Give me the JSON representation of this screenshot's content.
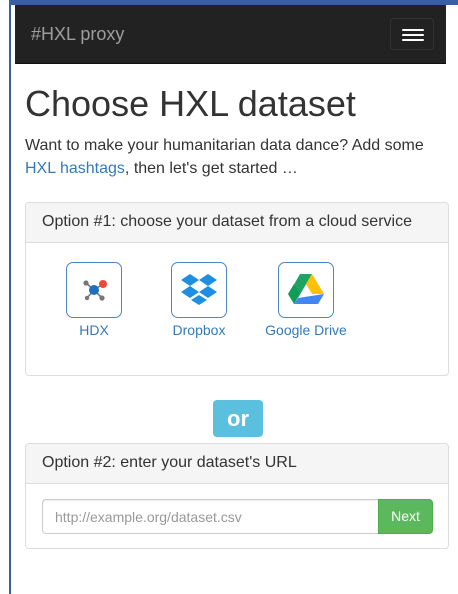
{
  "navbar": {
    "brand": "#HXL proxy",
    "menu_icon": "hamburger-icon"
  },
  "page": {
    "title": "Choose HXL dataset",
    "intro_before": "Want to make your humanitarian data dance? Add some ",
    "intro_link": "HXL hashtags",
    "intro_after": ", then let's get started …"
  },
  "option1": {
    "heading": "Option #1: choose your dataset from a cloud service",
    "services": [
      {
        "label": "HDX",
        "icon": "hdx-icon"
      },
      {
        "label": "Dropbox",
        "icon": "dropbox-icon"
      },
      {
        "label": "Google Drive",
        "icon": "google-drive-icon"
      }
    ]
  },
  "divider": {
    "label": "or"
  },
  "option2": {
    "heading": "Option #2: enter your dataset's URL",
    "url_placeholder": "http://example.org/dataset.csv",
    "url_value": "",
    "next_label": "Next"
  },
  "colors": {
    "navbar": "#222222",
    "link": "#337ab7",
    "or_badge": "#5bc0de",
    "next_button": "#5cb85c"
  }
}
